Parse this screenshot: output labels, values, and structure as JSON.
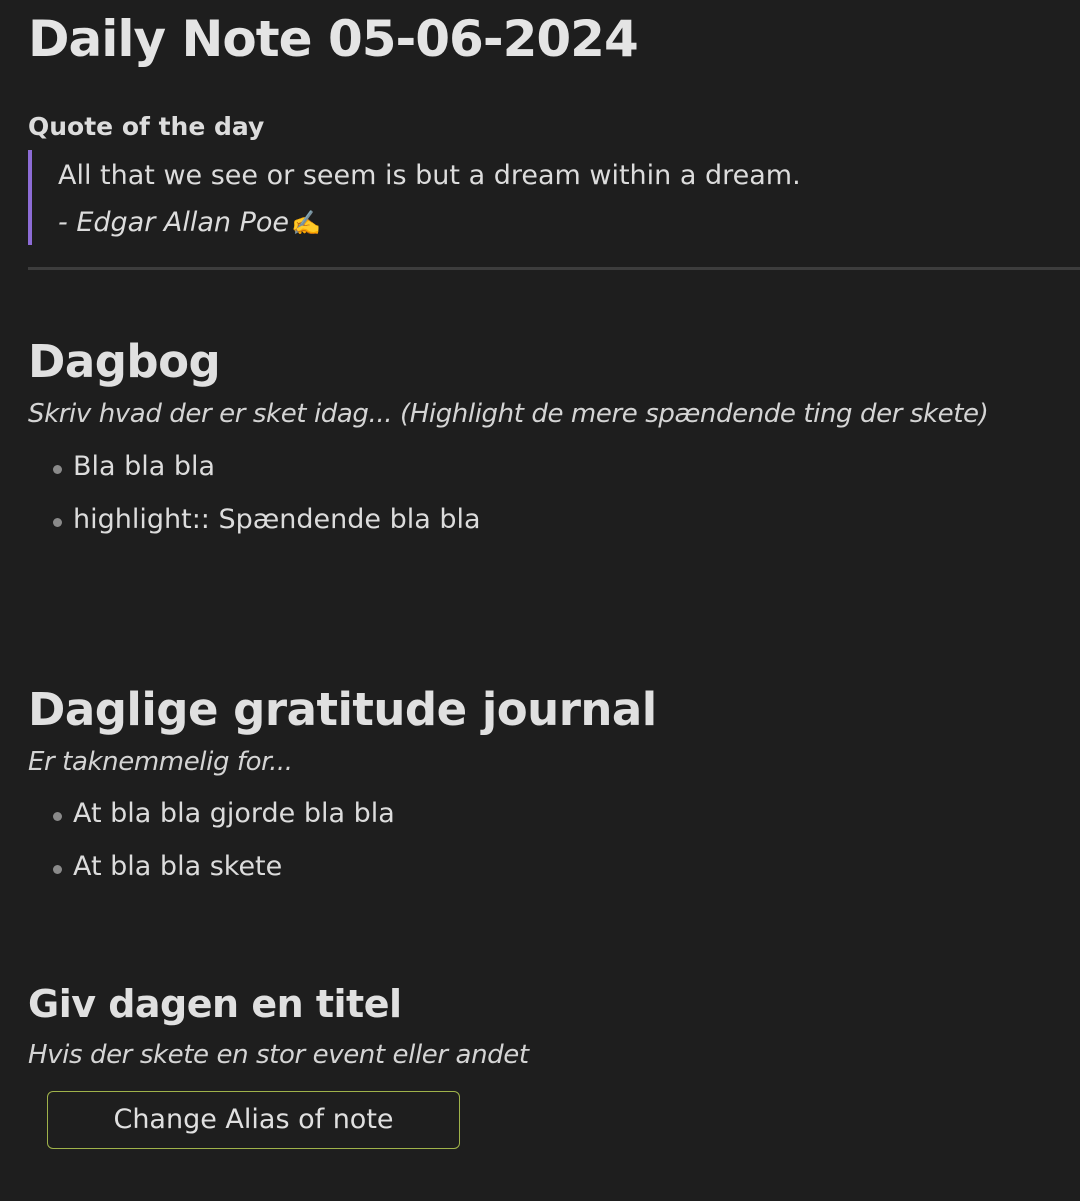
{
  "note": {
    "title": "Daily Note 05-06-2024",
    "quote_section": {
      "heading": "Quote of the day",
      "text": "All that we see or seem is but a dream within a dream.",
      "author": "- Edgar Allan Poe",
      "emoji": "✍️"
    },
    "dagbog": {
      "heading": "Dagbog",
      "hint": "Skriv hvad der er sket idag... (Highlight de mere spændende ting der skete)",
      "items": [
        "Bla bla bla",
        "highlight:: Spændende bla bla"
      ]
    },
    "gratitude": {
      "heading": "Daglige gratitude journal",
      "hint": "Er taknemmelig for...",
      "items": [
        "At bla bla gjorde bla bla",
        "At bla bla skete"
      ]
    },
    "title_section": {
      "heading": "Giv dagen en titel",
      "hint": "Hvis der skete en stor event eller andet",
      "button_label": "Change Alias of note"
    }
  },
  "colors": {
    "background": "#1e1e1e",
    "quote_border": "#8d6cd6",
    "button_border": "#9fb24a",
    "bullet": "#8a8a8a"
  }
}
